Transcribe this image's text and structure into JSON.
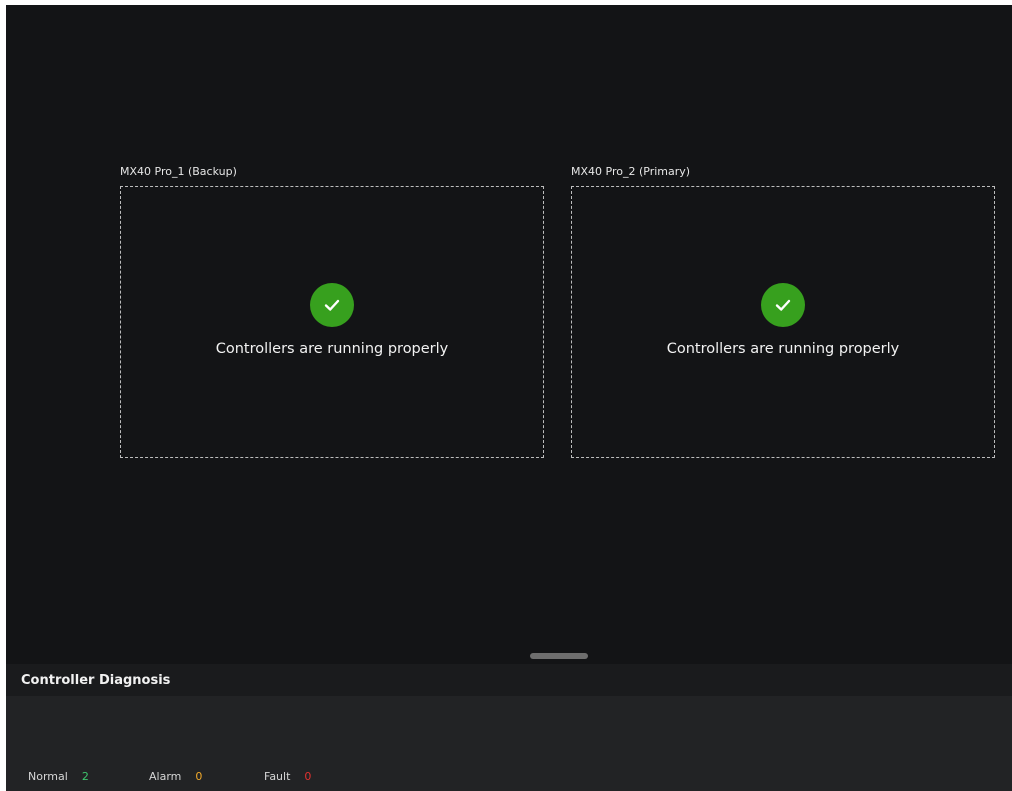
{
  "controllers": [
    {
      "title": "MX40 Pro_1 (Backup)",
      "status": "Controllers are running properly",
      "status_icon": "check-icon",
      "status_color": "#37a01e"
    },
    {
      "title": "MX40 Pro_2 (Primary)",
      "status": "Controllers are running properly",
      "status_icon": "check-icon",
      "status_color": "#37a01e"
    }
  ],
  "diagnosis": {
    "title": "Controller Diagnosis",
    "stats": [
      {
        "label": "Normal",
        "count": "2",
        "color": "#3ec46d"
      },
      {
        "label": "Alarm",
        "count": "0",
        "color": "#f0a82a"
      },
      {
        "label": "Fault",
        "count": "0",
        "color": "#e0312f"
      }
    ]
  },
  "colors": {
    "background": "#131416",
    "panel": "#222325",
    "success": "#37a01e"
  }
}
